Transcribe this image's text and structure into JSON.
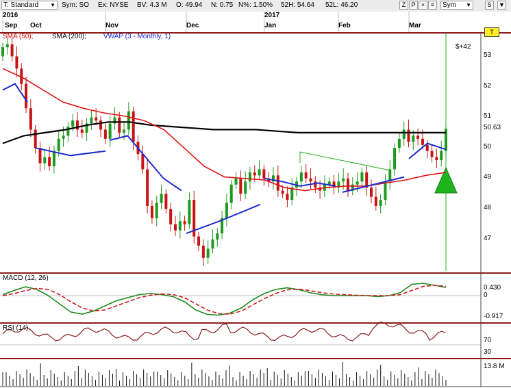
{
  "toolbar": {
    "template": "T: Standard",
    "symbol": "Sym: SO",
    "exchange": "Ex: NYSE",
    "bv": "BV: 4.3 M",
    "open": "O: 49.94",
    "net": "N: 0.75",
    "pct": "N%: 1.50%",
    "high52": "52H: 54.64",
    "low52": "52L: 46.20",
    "btn_z": "Z",
    "btn_p": "P",
    "btn_close": "×",
    "btn_menu": "≡",
    "sym_dropdown": "Sym",
    "btn_s": "S"
  },
  "header": {
    "year1": "2016",
    "year2": "2017",
    "months": [
      "Sep",
      "Oct",
      "Nov",
      "Dec",
      "Jan",
      "Feb",
      "Mar"
    ]
  },
  "price_pane": {
    "legend_sma50": "SMA (50);",
    "legend_sma200": "SMA (200);",
    "legend_vwap": "VWAP (3 - Monthly, 1)",
    "gain_label": "$+42",
    "last_price": "50.63",
    "trade_marker": "T",
    "y_ticks": [
      "53",
      "52",
      "51",
      "50",
      "49",
      "48",
      "47"
    ],
    "colors": {
      "sma50": "#e01010",
      "sma200": "#000000",
      "vwap": "#1a2ad0",
      "up": "#1e9a1e",
      "down": "#c81414",
      "signal": "#1eb41e"
    }
  },
  "macd_pane": {
    "label": "MACD (12, 26)",
    "ticks": [
      "0.430",
      "0",
      "-0.917"
    ]
  },
  "rsi_pane": {
    "label": "RSI (14)",
    "ticks": [
      "70",
      "30"
    ]
  },
  "volume_pane": {
    "label": "13.8 M"
  },
  "chart_data": {
    "type": "candlestick",
    "x_range": [
      "2016-09",
      "2017-03"
    ],
    "y_range": [
      46.2,
      53.6
    ],
    "series": [
      {
        "name": "SMA (50)",
        "values": [
          52.6,
          52.3,
          51.9,
          51.5,
          51.3,
          51.15,
          51.05,
          50.9,
          50.6,
          50.0,
          49.4,
          49.05,
          49.0,
          48.95,
          48.7,
          48.6,
          48.7,
          48.75,
          48.75,
          48.85,
          48.95,
          49.1,
          49.2
        ]
      },
      {
        "name": "SMA (200)",
        "values": [
          50.15,
          50.4,
          50.5,
          50.6,
          50.75,
          50.85,
          50.85,
          50.75,
          50.7,
          50.65,
          50.6,
          50.6,
          50.6,
          50.55,
          50.5,
          50.5,
          50.5,
          50.5,
          50.5,
          50.5,
          50.5,
          50.5
        ]
      },
      {
        "name": "VWAP (3 - Monthly, 1)",
        "values": [
          51.9,
          52.1,
          51.5,
          50.0,
          49.75,
          49.9,
          50.25,
          50.4,
          49.7,
          49.0,
          48.6,
          47.2,
          47.65,
          48.15,
          49.0,
          48.9,
          48.75,
          48.85,
          48.75,
          48.55,
          49.05,
          49.65,
          50.15,
          49.95
        ]
      }
    ],
    "macd": {
      "label": "MACD (12, 26)",
      "upper": 0.43,
      "lower": -0.917
    },
    "rsi": {
      "label": "RSI (14)",
      "levels": [
        70,
        30
      ]
    },
    "volume": {
      "max_label": "13.8 M"
    }
  }
}
